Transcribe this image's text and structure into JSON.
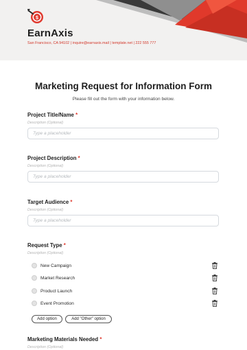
{
  "header": {
    "brand": "EarnAxis",
    "contact": "San Francisco, CA 94102 | inquire@earnaxis.mail | template.net | 222 555 777",
    "colors": {
      "accent": "#e03a2f",
      "dark": "#2b2b2b",
      "bg": "#f2f1f0"
    }
  },
  "form": {
    "title": "Marketing Request for Information Form",
    "subtitle": "Please fill out the form with your information below.",
    "required_marker": "*",
    "fields": [
      {
        "label": "Project Title/Name",
        "description": "Description (Optional)",
        "placeholder": "Type a placeholder"
      },
      {
        "label": "Project Description",
        "description": "Description (Optional)",
        "placeholder": "Type a placeholder"
      },
      {
        "label": "Target Audience",
        "description": "Description (Optional)",
        "placeholder": "Type a placeholder"
      }
    ],
    "request_type": {
      "label": "Request Type",
      "description": "Description (Optional)",
      "options": [
        "New Campaign",
        "Market Research",
        "Product Launch",
        "Event Promotion"
      ],
      "add_option": "Add option",
      "add_other": "Add \"Other\" option"
    },
    "materials": {
      "label": "Marketing Materials Needed",
      "description": "Description (Optional)"
    }
  },
  "icons": {
    "logo": "target-dollar-icon",
    "delete": "trash-icon"
  }
}
